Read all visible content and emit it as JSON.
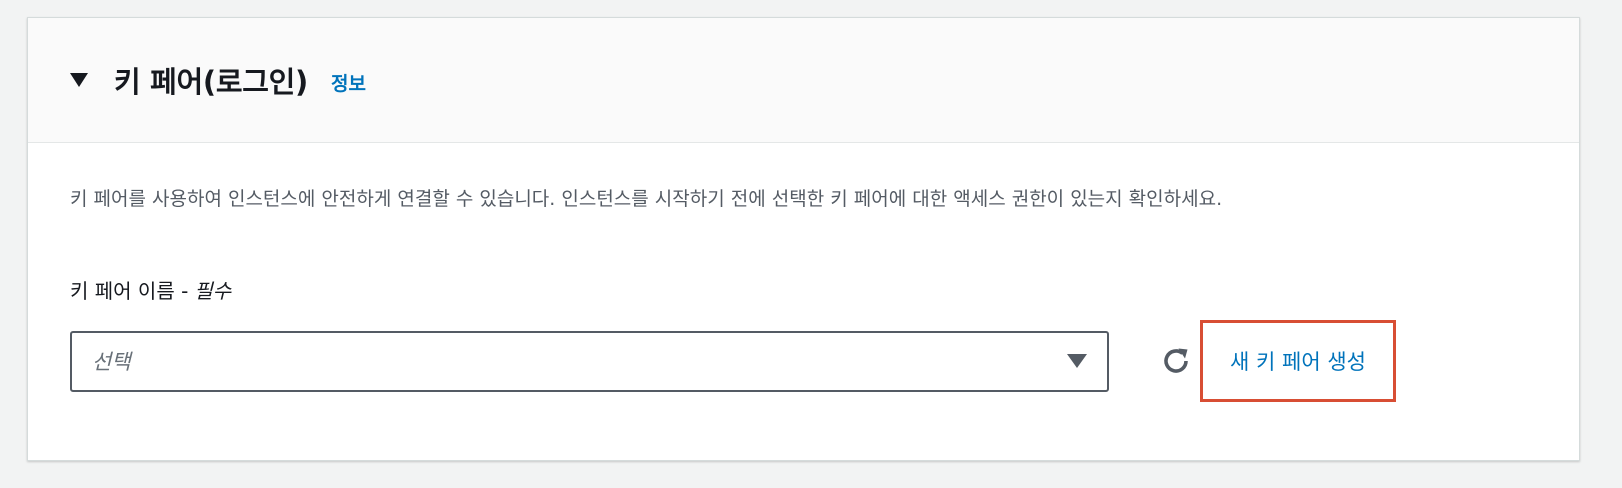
{
  "panel": {
    "title": "키 페어(로그인)",
    "info_link": "정보",
    "description": "키 페어를 사용하여 인스턴스에 안전하게 연결할 수 있습니다. 인스턴스를 시작하기 전에 선택한 키 페어에 대한 액세스 권한이 있는지 확인하세요.",
    "field": {
      "label": "키 페어 이름 -",
      "required": "필수",
      "placeholder": "선택"
    },
    "create_link": "새 키 페어 생성"
  },
  "icons": {
    "collapse": "caret-down-icon",
    "dropdown": "caret-down-icon",
    "refresh": "refresh-icon"
  },
  "colors": {
    "link": "#0073bb",
    "highlight_border": "#d84e34",
    "header_bg": "#fafafa",
    "page_bg": "#f2f3f3"
  }
}
